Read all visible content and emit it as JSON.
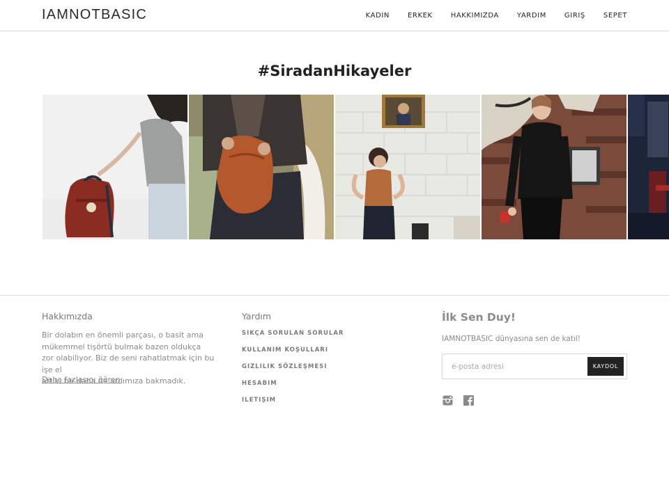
{
  "brand": {
    "logo": "IAMNOTBASIC"
  },
  "nav": {
    "items": [
      {
        "label": "KADIN"
      },
      {
        "label": "ERKEK"
      },
      {
        "label": "HAKKIMIZDA"
      },
      {
        "label": "YARDIM"
      },
      {
        "label": "GIRIŞ"
      },
      {
        "label": "SEPET"
      }
    ]
  },
  "stories": {
    "title": "#SiradanHikayeler",
    "tiles": [
      {
        "scene": "woman-with-red-backpack"
      },
      {
        "scene": "man-with-leather-backpack"
      },
      {
        "scene": "woman-laughing-brick-wall"
      },
      {
        "scene": "woman-black-outfit-brick-wall"
      },
      {
        "scene": "dark-interior-partial"
      }
    ]
  },
  "footer": {
    "about": {
      "title": "Hakkımızda",
      "lines": [
        "Bir dolabın en önemli parçası, o basit ama",
        "mükemmel tişörtü bulmak bazen oldukça",
        "zor olabiliyor. Biz de seni rahatlatmak için bu işe el",
        "attık, bir daha da ardımıza bakmadık."
      ],
      "link": "Daha fazlasını öğren"
    },
    "help": {
      "title": "Yardım",
      "items": [
        {
          "label": "SIKÇA SORULAN SORULAR"
        },
        {
          "label": "KULLANIM KOŞULLARI"
        },
        {
          "label": "GIZLILIK SÖZLEŞMESI"
        },
        {
          "label": "HESABIM"
        },
        {
          "label": "ILETIŞIM"
        }
      ]
    },
    "newsletter": {
      "title": "İlk Sen Duy!",
      "subtitle": "IAMNOTBASIC dünyasına sen de katıl!",
      "placeholder": "e-posta adresi",
      "button": "KAYDOL"
    },
    "social": [
      {
        "icon": "instagram-icon"
      },
      {
        "icon": "facebook-icon"
      }
    ]
  }
}
